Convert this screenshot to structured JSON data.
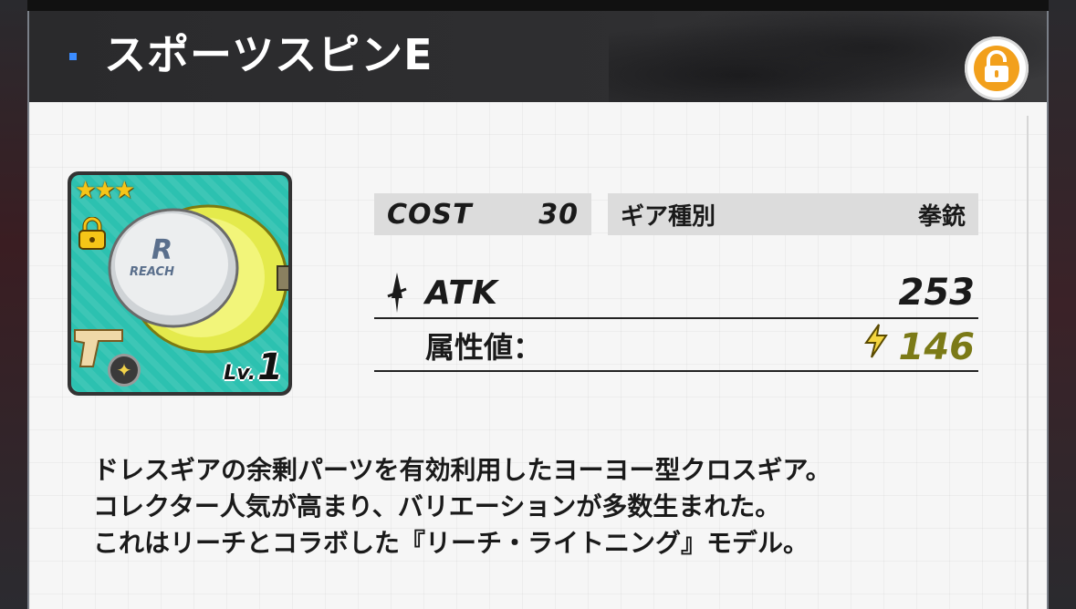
{
  "item": {
    "name": "スポーツスピンE",
    "rarity_stars": 3,
    "level_prefix": "Lv.",
    "level": "1",
    "logo_text": "REACH"
  },
  "stats": {
    "cost_label": "COST",
    "cost_value": "30",
    "type_label": "ギア種別",
    "type_value": "拳銃",
    "atk_label": "ATK",
    "atk_value": "253",
    "element_label": "属性値：",
    "element_value": "146"
  },
  "description": {
    "lines": [
      "ドレスギアの余剰パーツを有効利用したヨーヨー型クロスギア。",
      "コレクター人気が高まり、バリエーションが多数生まれた。",
      "これはリーチとコラボした『リーチ・ライトニング』モデル。"
    ]
  },
  "icons": {
    "lock": "lock-open-icon",
    "atk": "sword-icon",
    "element": "lightning-icon"
  },
  "colors": {
    "lock_orange": "#f2a01c",
    "element_value": "#7b7a17",
    "icon_bg": "#2cc1b0",
    "yoyo_yellow": "#eaf05a"
  }
}
